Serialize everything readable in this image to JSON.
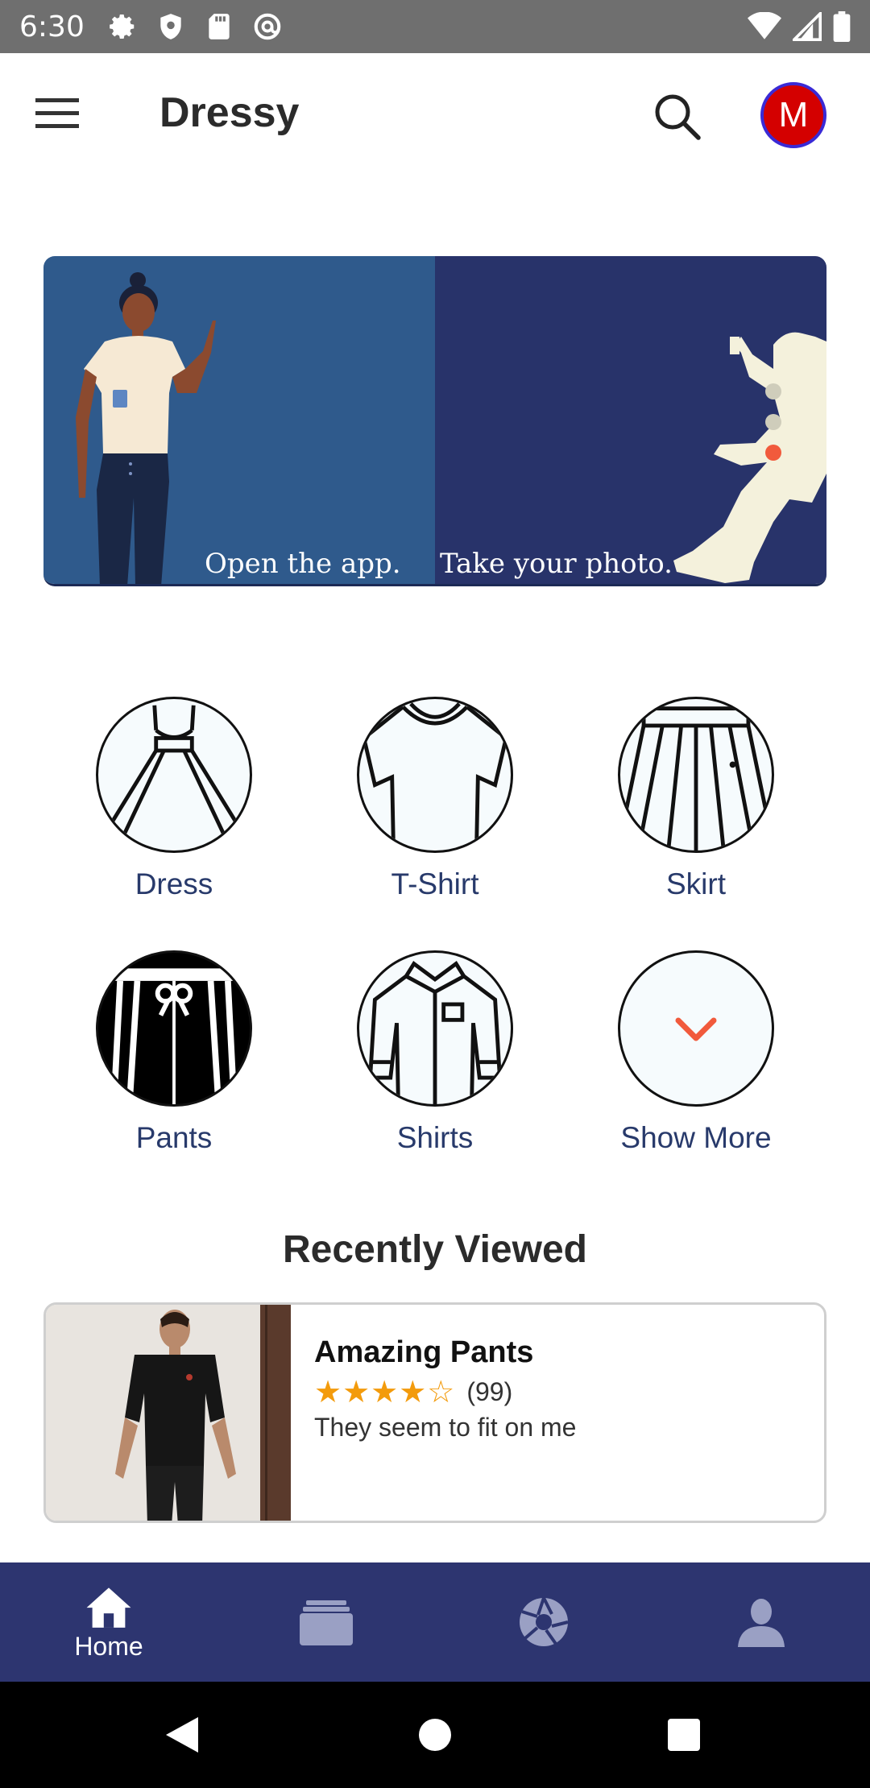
{
  "status_bar": {
    "time": "6:30",
    "left_icons": [
      "settings-icon",
      "shield-icon",
      "sd-card-icon",
      "at-sign-icon"
    ],
    "right_icons": [
      "wifi-icon",
      "cell-signal-icon",
      "battery-icon"
    ]
  },
  "app_bar": {
    "title": "Dressy",
    "menu_icon": "hamburger-menu-icon",
    "search_icon": "search-icon",
    "avatar_letter": "M",
    "avatar_color": "#d40000"
  },
  "banner": {
    "left_caption": "Open the app.",
    "right_caption": "Take your photo.",
    "left_color": "#2f5a8c",
    "right_color": "#28336a"
  },
  "categories": [
    {
      "label": "Dress",
      "icon": "dress-icon"
    },
    {
      "label": "T-Shirt",
      "icon": "tshirt-icon"
    },
    {
      "label": "Skirt",
      "icon": "skirt-icon"
    },
    {
      "label": "Pants",
      "icon": "pants-icon"
    },
    {
      "label": "Shirts",
      "icon": "shirt-icon"
    },
    {
      "label": "Show More",
      "icon": "chevron-down-icon"
    }
  ],
  "recently_viewed": {
    "title": "Recently Viewed",
    "items": [
      {
        "name": "Amazing Pants",
        "stars": "★★★★☆",
        "rating_count": "(99)",
        "description": "They seem to fit on me"
      }
    ]
  },
  "bottom_nav": {
    "items": [
      {
        "label": "Home",
        "icon": "home-icon",
        "active": true
      },
      {
        "label": "",
        "icon": "stack-cards-icon",
        "active": false
      },
      {
        "label": "",
        "icon": "camera-aperture-icon",
        "active": false
      },
      {
        "label": "",
        "icon": "person-icon",
        "active": false
      }
    ]
  },
  "colors": {
    "accent_navy": "#2d3570",
    "category_label": "#283a6b",
    "star": "#f39b0c",
    "chevron": "#f15a3c"
  }
}
